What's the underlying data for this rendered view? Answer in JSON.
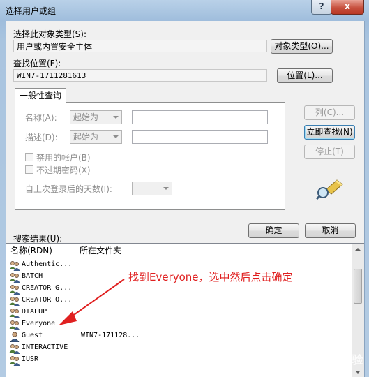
{
  "window": {
    "title": "选择用户或组",
    "help_glyph": "?",
    "close_glyph": "x"
  },
  "object_type": {
    "label": "选择此对象类型(S):",
    "value": "用户或内置安全主体",
    "button": "对象类型(O)..."
  },
  "location": {
    "label": "查找位置(F):",
    "value": "WIN7-1711281613",
    "button": "位置(L)..."
  },
  "query_tab": {
    "tab_label": "一般性查询",
    "name_label": "名称(A):",
    "name_mode": "起始为",
    "desc_label": "描述(D):",
    "desc_mode": "起始为",
    "disabled_accounts": "禁用的帐户(B)",
    "nonexpiring_pwd": "不过期密码(X)",
    "days_label": "自上次登录后的天数(I):"
  },
  "side_buttons": {
    "columns": "列(C)...",
    "find_now": "立即查找(N)",
    "stop": "停止(T)"
  },
  "results": {
    "label": "搜索结果(U):",
    "ok": "确定",
    "cancel": "取消",
    "columns": [
      "名称(RDN)",
      "所在文件夹"
    ],
    "rows": [
      {
        "name": "Authentic...",
        "folder": "",
        "icon": "group-icon"
      },
      {
        "name": "BATCH",
        "folder": "",
        "icon": "group-icon"
      },
      {
        "name": "CREATOR G...",
        "folder": "",
        "icon": "group-icon"
      },
      {
        "name": "CREATOR O...",
        "folder": "",
        "icon": "group-icon"
      },
      {
        "name": "DIALUP",
        "folder": "",
        "icon": "group-icon"
      },
      {
        "name": "Everyone",
        "folder": "",
        "icon": "group-icon"
      },
      {
        "name": "Guest",
        "folder": "WIN7-171128...",
        "icon": "user-icon"
      },
      {
        "name": "INTERACTIVE",
        "folder": "",
        "icon": "group-icon"
      },
      {
        "name": "IUSR",
        "folder": "",
        "icon": "group-icon"
      }
    ]
  },
  "annotation": {
    "text": "找到Everyone，选中然后点击确定",
    "color": "#e02020"
  },
  "watermark": {
    "text": "Baidu经验"
  }
}
